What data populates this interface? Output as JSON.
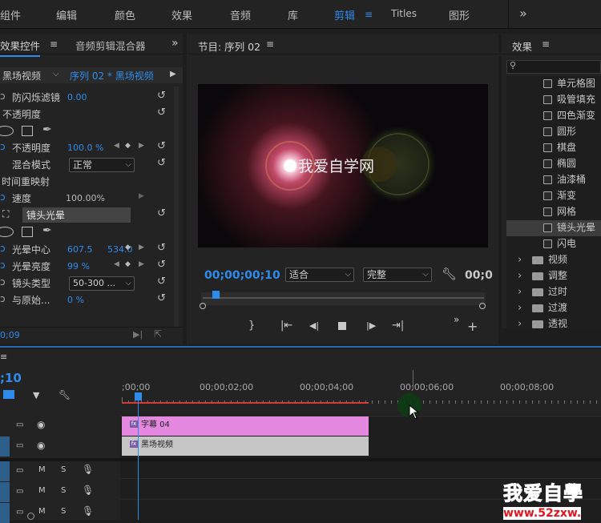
{
  "menu": {
    "items": [
      "组件",
      "编辑",
      "颜色",
      "效果",
      "音频",
      "库",
      "剪辑",
      "Titles",
      "图形"
    ],
    "active": "剪辑",
    "more": "»"
  },
  "effect_controls": {
    "tab_title": "效果控件",
    "tab_audio": "音频剪辑混合器",
    "source_clip": "黑场视频",
    "sequence_clip": "序列 02 * 黑场视频",
    "rows": {
      "antiflicker_label": "防闪烁滤镜",
      "antiflicker_value": "0.00",
      "opacity_section": "不透明度",
      "opacity_label": "不透明度",
      "opacity_value": "100.0 %",
      "blend_label": "混合模式",
      "blend_value": "正常",
      "time_remap": "时间重映射",
      "speed_label": "速度",
      "speed_value": "100.00%",
      "lens_flare": "镜头光晕",
      "flare_center_label": "光晕中心",
      "flare_center_x": "607.5",
      "flare_center_y": "534.0",
      "flare_brightness_label": "光晕亮度",
      "flare_brightness_value": "99 %",
      "lens_type_label": "镜头类型",
      "lens_type_value": "50-300 ...",
      "blend_original_label": "与原始...",
      "blend_original_value": "0 %"
    },
    "footer_time": "0;09"
  },
  "program_monitor": {
    "title": "节目: 序列 02",
    "overlay_text": "我爱自学网",
    "timecode": "00;00;00;10",
    "fit_value": "适合",
    "quality_value": "完整",
    "duration": "00;0"
  },
  "effects_panel": {
    "title": "效果",
    "items": [
      "单元格图",
      "吸管填充",
      "四色渐变",
      "圆形",
      "棋盘",
      "椭圆",
      "油漆桶",
      "渐变",
      "网格",
      "镜头光晕",
      "闪电"
    ],
    "selected": "镜头光晕",
    "folders": [
      "视频",
      "调整",
      "过时",
      "过渡",
      "透视"
    ]
  },
  "timeline": {
    "timecode": ";10",
    "ruler_labels": [
      ";00;00",
      "00;00;02;00",
      "00;00;04;00",
      "00;00;06;00",
      "00;00;08;00"
    ],
    "clips": {
      "title_clip": "字幕 04",
      "black_clip": "黑场视频"
    },
    "track_letters": {
      "mute": "M",
      "solo": "S"
    }
  },
  "watermark": {
    "text": "我爱自學",
    "url": "www.52zxw."
  },
  "colors": {
    "accent": "#2d8ceb",
    "title_clip": "#e488e0",
    "black_clip": "#c6c6c6",
    "playhead": "#2d8ceb",
    "watermark_red": "#e4141e"
  }
}
